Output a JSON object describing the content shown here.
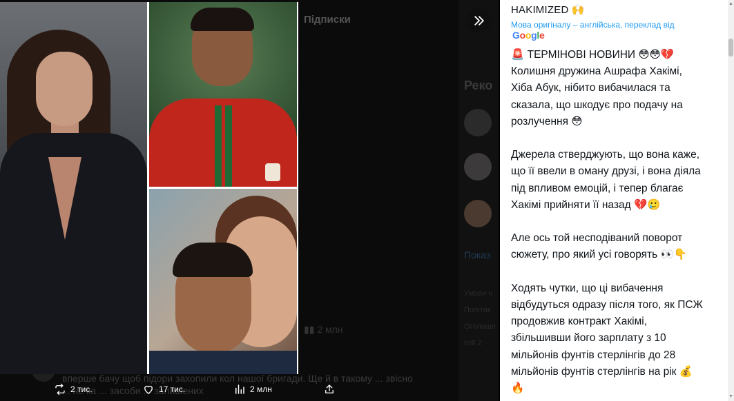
{
  "background": {
    "tab_label": "Підписки",
    "recommend_label": "Реко",
    "show_more": "Показ",
    "fine_print": [
      "Умови н",
      "Політик",
      "Оголоше",
      "mill 2"
    ],
    "stat_views": "2 млн",
    "partial_text": "вперше бачу щоб підори захопили кол нашої бригади. Ще й в такому ... звісно ... не ка ... засоби ... залишених"
  },
  "media": {
    "collage": [
      "portrait-woman",
      "portrait-footballer",
      "couple-selfie"
    ]
  },
  "actions": {
    "retweets": "2 тис.",
    "likes": "17 тис.",
    "views": "2 млн"
  },
  "panel": {
    "author": "HAKIMIZED 🙌",
    "translation_note": "Мова оригіналу – англійська, переклад від",
    "google": [
      "G",
      "o",
      "o",
      "g",
      "l",
      "e"
    ],
    "google_colors": [
      "#4285F4",
      "#EA4335",
      "#FBBC05",
      "#4285F4",
      "#34A853",
      "#EA4335"
    ],
    "post_text": "🚨 ТЕРМІНОВІ НОВИНИ 😳😳💔\nКолишня дружина Ашрафа Хакімі,\nХіба Абук, нібито вибачилася та\nсказала, що шкодує про подачу на\nрозлучення 😳\n\nДжерела стверджують, що вона каже,\nщо її ввели в оману друзі, і вона діяла\nпід впливом емоцій, і тепер благає\nХакімі прийняти її назад 💔🥲\n\nАле ось той несподіваний поворот\nсюжету, про який усі говорять 👀👇\n\nХодять чутки, що ці вибачення\nвідбудуться одразу після того, як ПСЖ\nпродовжив контракт Хакімі,\nзбільшивши його зарплату з 10\nмільйонів фунтів стерлінгів до 28\nмільйонів фунтів стерлінгів на рік 💰\n🔥"
  },
  "colors": {
    "accent": "#1d9bf0",
    "text": "#0f1419",
    "overlay_bg": "#000000"
  }
}
